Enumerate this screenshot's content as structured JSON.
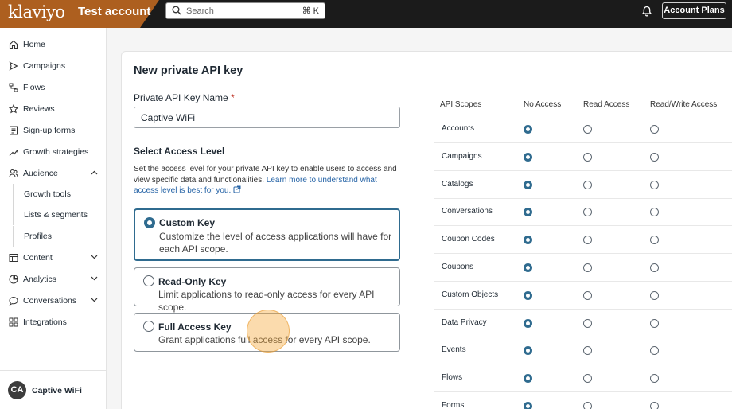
{
  "topbar": {
    "logo_text": "klaviyo",
    "account_label": "Test account",
    "search_placeholder": "Search",
    "search_shortcut": "⌘ K",
    "account_plans_label": "Account Plans",
    "brand_color": "#ad5f1f"
  },
  "sidebar": {
    "items": [
      {
        "label": "Home",
        "icon": "home-icon"
      },
      {
        "label": "Campaigns",
        "icon": "send-icon"
      },
      {
        "label": "Flows",
        "icon": "flows-icon"
      },
      {
        "label": "Reviews",
        "icon": "star-icon"
      },
      {
        "label": "Sign-up forms",
        "icon": "form-icon"
      },
      {
        "label": "Growth strategies",
        "icon": "trend-icon"
      },
      {
        "label": "Audience",
        "icon": "audience-icon"
      }
    ],
    "audience_sub": [
      "Growth tools",
      "Lists & segments",
      "Profiles"
    ],
    "lower_items": [
      {
        "label": "Content",
        "icon": "content-icon"
      },
      {
        "label": "Analytics",
        "icon": "analytics-icon"
      },
      {
        "label": "Conversations",
        "icon": "chat-icon"
      },
      {
        "label": "Integrations",
        "icon": "integrations-icon"
      }
    ],
    "account": {
      "initials": "CA",
      "name": "Captive WiFi"
    }
  },
  "form": {
    "title": "New private API key",
    "name_label": "Private API Key Name",
    "required_mark": "*",
    "name_value": "Captive WiFi",
    "access_section_title": "Select Access Level",
    "description": "Set the access level for your private API key to enable users to access and view specific data and functionalities.",
    "learn_more": "Learn more to understand what access level is best for you.",
    "options": [
      {
        "title": "Custom Key",
        "desc": "Customize the level of access applications will have for each API scope.",
        "selected": true
      },
      {
        "title": "Read-Only Key",
        "desc": "Limit applications to read-only access for every API scope.",
        "selected": false
      },
      {
        "title": "Full Access Key",
        "desc": "Grant applications full access for every API scope.",
        "selected": false
      }
    ]
  },
  "scopes": {
    "headers": [
      "API Scopes",
      "No Access",
      "Read Access",
      "Read/Write Access"
    ],
    "rows": [
      {
        "name": "Accounts",
        "value": "No Access"
      },
      {
        "name": "Campaigns",
        "value": "No Access"
      },
      {
        "name": "Catalogs",
        "value": "No Access"
      },
      {
        "name": "Conversations",
        "value": "No Access"
      },
      {
        "name": "Coupon Codes",
        "value": "No Access"
      },
      {
        "name": "Coupons",
        "value": "No Access"
      },
      {
        "name": "Custom Objects",
        "value": "No Access"
      },
      {
        "name": "Data Privacy",
        "value": "No Access"
      },
      {
        "name": "Events",
        "value": "No Access"
      },
      {
        "name": "Flows",
        "value": "No Access"
      },
      {
        "name": "Forms",
        "value": "No Access"
      }
    ]
  }
}
